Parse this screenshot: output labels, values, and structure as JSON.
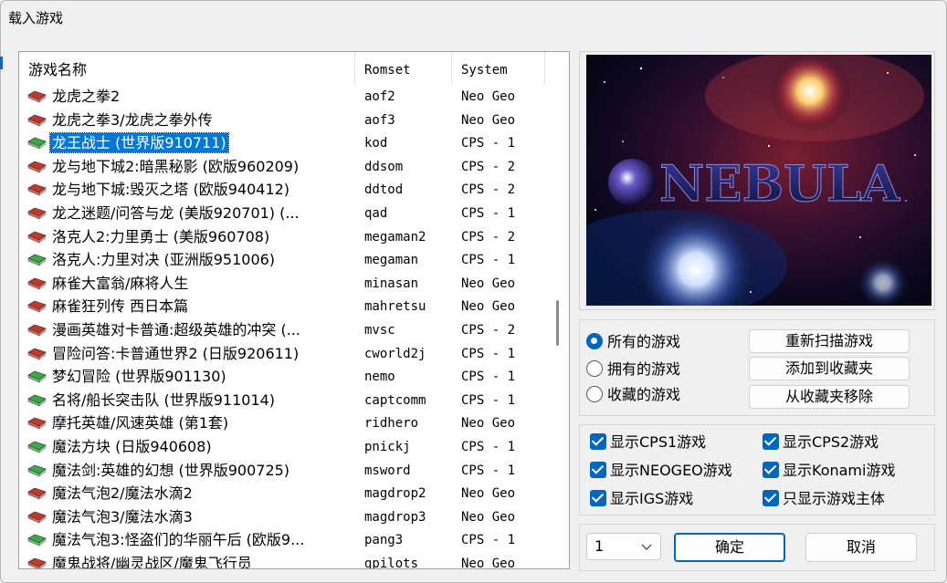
{
  "window": {
    "title": "载入游戏"
  },
  "list": {
    "columns": {
      "name": "游戏名称",
      "romset": "Romset",
      "system": "System"
    },
    "rows": [
      {
        "name": "龙虎之拳2",
        "romset": "aof2",
        "system": "Neo Geo",
        "icon": "red"
      },
      {
        "name": "龙虎之拳3/龙虎之拳外传",
        "romset": "aof3",
        "system": "Neo Geo",
        "icon": "red"
      },
      {
        "name": "龙王战士 (世界版910711)",
        "romset": "kod",
        "system": "CPS - 1",
        "icon": "green",
        "selected": true
      },
      {
        "name": "龙与地下城2:暗黑秘影 (欧版960209)",
        "romset": "ddsom",
        "system": "CPS - 2",
        "icon": "red"
      },
      {
        "name": "龙与地下城:毁灭之塔 (欧版940412)",
        "romset": "ddtod",
        "system": "CPS - 2",
        "icon": "red"
      },
      {
        "name": "龙之迷题/问答与龙 (美版920701) (...",
        "romset": "qad",
        "system": "CPS - 1",
        "icon": "red"
      },
      {
        "name": "洛克人2:力里勇士 (美版960708)",
        "romset": "megaman2",
        "system": "CPS - 2",
        "icon": "red"
      },
      {
        "name": "洛克人:力里对决 (亚洲版951006)",
        "romset": "megaman",
        "system": "CPS - 1",
        "icon": "green"
      },
      {
        "name": "麻雀大富翁/麻将人生",
        "romset": "minasan",
        "system": "Neo Geo",
        "icon": "red"
      },
      {
        "name": "麻雀狂列传 西日本篇",
        "romset": "mahretsu",
        "system": "Neo Geo",
        "icon": "red"
      },
      {
        "name": "漫画英雄对卡普通:超级英雄的冲突 (...",
        "romset": "mvsc",
        "system": "CPS - 2",
        "icon": "red"
      },
      {
        "name": "冒险问答:卡普通世界2 (日版920611)",
        "romset": "cworld2j",
        "system": "CPS - 1",
        "icon": "red"
      },
      {
        "name": "梦幻冒险 (世界版901130)",
        "romset": "nemo",
        "system": "CPS - 1",
        "icon": "green"
      },
      {
        "name": "名将/船长突击队 (世界版911014)",
        "romset": "captcomm",
        "system": "CPS - 1",
        "icon": "green"
      },
      {
        "name": "摩托英雄/风速英雄 (第1套)",
        "romset": "ridhero",
        "system": "Neo Geo",
        "icon": "red"
      },
      {
        "name": "魔法方块 (日版940608)",
        "romset": "pnickj",
        "system": "CPS - 1",
        "icon": "green"
      },
      {
        "name": "魔法剑:英雄的幻想 (世界版900725)",
        "romset": "msword",
        "system": "CPS - 1",
        "icon": "green"
      },
      {
        "name": "魔法气泡2/魔法水滴2",
        "romset": "magdrop2",
        "system": "Neo Geo",
        "icon": "red"
      },
      {
        "name": "魔法气泡3/魔法水滴3",
        "romset": "magdrop3",
        "system": "Neo Geo",
        "icon": "red"
      },
      {
        "name": "魔法气泡3:怪盗们的华丽午后 (欧版9...",
        "romset": "pang3",
        "system": "CPS - 1",
        "icon": "green"
      },
      {
        "name": "魔鬼战将/幽灵战区/魔鬼飞行员",
        "romset": "gpilots",
        "system": "Neo Geo",
        "icon": "red"
      }
    ]
  },
  "preview": {
    "logo_text": "NEBULA"
  },
  "filters": {
    "radios": [
      {
        "label": "所有的游戏",
        "checked": true
      },
      {
        "label": "拥有的游戏",
        "checked": false
      },
      {
        "label": "收藏的游戏",
        "checked": false
      }
    ],
    "buttons": {
      "rescan": "重新扫描游戏",
      "add_fav": "添加到收藏夹",
      "remove_fav": "从收藏夹移除"
    }
  },
  "systems": {
    "checks": [
      {
        "label": "显示CPS1游戏",
        "checked": true
      },
      {
        "label": "显示CPS2游戏",
        "checked": true
      },
      {
        "label": "显示NEOGEO游戏",
        "checked": true
      },
      {
        "label": "显示Konami游戏",
        "checked": true
      },
      {
        "label": "显示IGS游戏",
        "checked": true
      },
      {
        "label": "只显示游戏主体",
        "checked": true
      }
    ]
  },
  "footer": {
    "select_value": "1",
    "ok": "确定",
    "cancel": "取消"
  },
  "colors": {
    "accent": "#0067c0",
    "selection": "#0078d7",
    "icon_red": "#c0392b",
    "icon_green": "#3aa845"
  }
}
